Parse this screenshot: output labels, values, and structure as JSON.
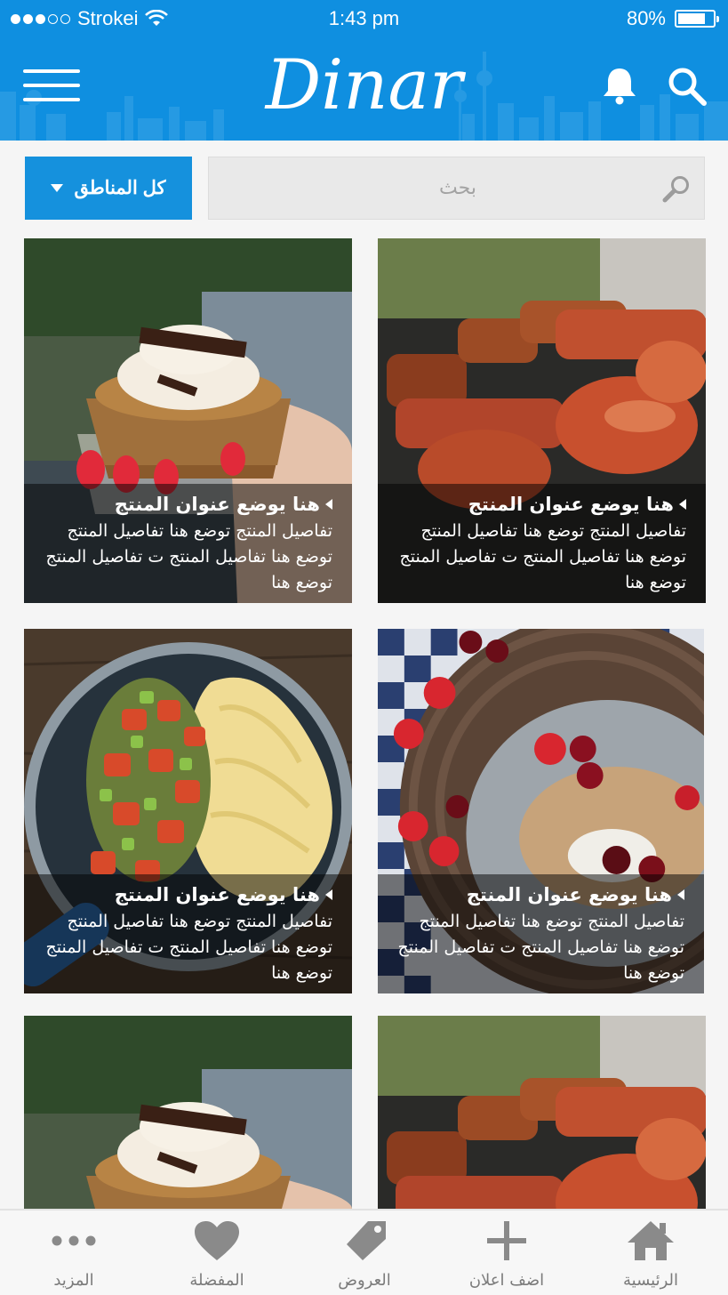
{
  "status_bar": {
    "carrier": "Strokei",
    "time": "1:43 pm",
    "battery": "80%",
    "battery_level": 0.8,
    "signal_bars_filled": 3,
    "signal_bars_total": 5
  },
  "header": {
    "logo": "Dinar",
    "menu_icon": "hamburger-menu-icon",
    "notification_icon": "bell-icon",
    "search_icon": "search-icon",
    "background_color": "#0f8fe0"
  },
  "search": {
    "placeholder": "بحث",
    "area_button_label": "كل المناطق",
    "area_button_icon": "caret-down-icon",
    "field_icon": "search-icon"
  },
  "products": [
    {
      "title": "هنا يوضع عنوان المنتج",
      "details": "تفاصيل المنتج توضع هنا تفاصيل المنتج توضع هنا تفاصيل المنتج ت تفاصيل المنتج توضع هنا",
      "image": "grilled-meat-photo"
    },
    {
      "title": "هنا يوضع عنوان المنتج",
      "details": "تفاصيل المنتج توضع هنا تفاصيل المنتج توضع هنا تفاصيل المنتج ت تفاصيل المنتج توضع هنا",
      "image": "cupcake-photo"
    },
    {
      "title": "هنا يوضع عنوان المنتج",
      "details": "تفاصيل المنتج توضع هنا تفاصيل المنتج توضع هنا تفاصيل المنتج ت تفاصيل المنتج توضع هنا",
      "image": "granola-berries-photo"
    },
    {
      "title": "هنا يوضع عنوان المنتج",
      "details": "تفاصيل المنتج توضع هنا تفاصيل المنتج توضع هنا تفاصيل المنتج ت تفاصيل المنتج توضع هنا",
      "image": "pasta-vegetables-pan-photo"
    },
    {
      "title": "",
      "details": "",
      "image": "grilled-meat-photo"
    },
    {
      "title": "",
      "details": "",
      "image": "cupcake-photo"
    }
  ],
  "tabbar": {
    "items": [
      {
        "label": "الرئيسية",
        "icon": "home-icon"
      },
      {
        "label": "اضف اعلان",
        "icon": "plus-icon"
      },
      {
        "label": "العروض",
        "icon": "tag-icon"
      },
      {
        "label": "المفضلة",
        "icon": "heart-icon"
      },
      {
        "label": "المزيد",
        "icon": "more-dots-icon"
      }
    ]
  }
}
